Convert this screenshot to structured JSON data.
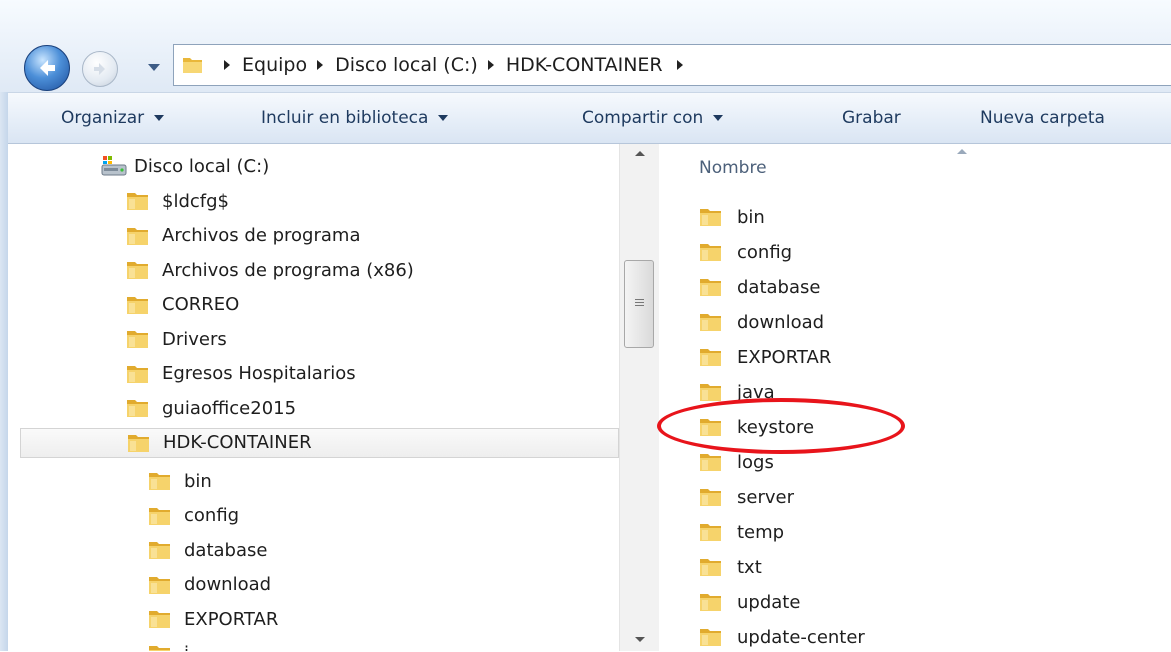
{
  "address_bar": {
    "breadcrumbs": [
      "Equipo",
      "Disco local (C:)",
      "HDK-CONTAINER"
    ]
  },
  "toolbar": {
    "organize_label": "Organizar",
    "include_library_label": "Incluir en biblioteca",
    "share_label": "Compartir con",
    "burn_label": "Grabar",
    "new_folder_label": "Nueva carpeta"
  },
  "tree": {
    "drive_label": "Disco local (C:)",
    "items": [
      {
        "label": "$ldcfg$"
      },
      {
        "label": "Archivos de programa"
      },
      {
        "label": "Archivos de programa (x86)"
      },
      {
        "label": "CORREO"
      },
      {
        "label": "Drivers"
      },
      {
        "label": "Egresos Hospitalarios"
      },
      {
        "label": "guiaoffice2015"
      },
      {
        "label": "HDK-CONTAINER",
        "selected": true
      }
    ],
    "subitems": [
      {
        "label": "bin"
      },
      {
        "label": "config"
      },
      {
        "label": "database"
      },
      {
        "label": "download"
      },
      {
        "label": "EXPORTAR"
      },
      {
        "label": "j"
      }
    ]
  },
  "content": {
    "column_header": "Nombre",
    "files": [
      {
        "label": "bin"
      },
      {
        "label": "config"
      },
      {
        "label": "database"
      },
      {
        "label": "download"
      },
      {
        "label": "EXPORTAR"
      },
      {
        "label": "java"
      },
      {
        "label": "keystore",
        "highlighted": true
      },
      {
        "label": "logs"
      },
      {
        "label": "server"
      },
      {
        "label": "temp"
      },
      {
        "label": "txt"
      },
      {
        "label": "update"
      },
      {
        "label": "update-center"
      }
    ]
  },
  "colors": {
    "highlight_ellipse": "#e8141b",
    "folder_yellow": "#f2c94c",
    "toolbar_text": "#1e3a5f"
  },
  "icons": {
    "back": "back-arrow-icon",
    "forward": "forward-arrow-icon",
    "folder": "folder-icon",
    "drive": "drive-icon"
  }
}
